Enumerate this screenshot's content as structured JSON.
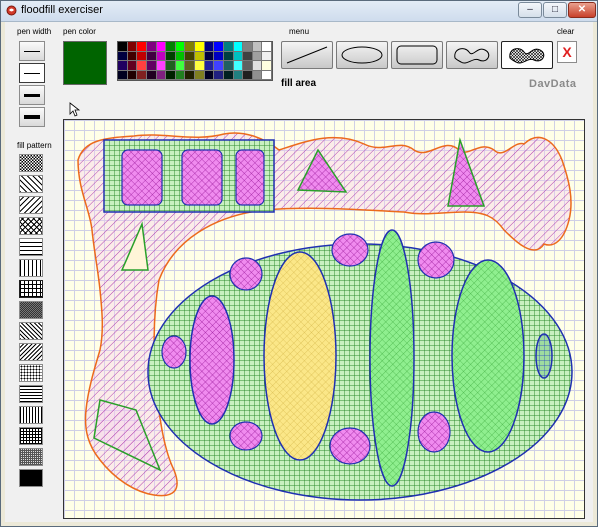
{
  "window": {
    "title": "floodfill exerciser",
    "minimize_glyph": "–",
    "maximize_glyph": "□",
    "close_glyph": "✕"
  },
  "toolbar": {
    "pen_width_label": "pen width",
    "pen_color_label": "pen color",
    "menu_label": "menu",
    "clear_label": "clear",
    "clear_glyph": "X",
    "fill_area_label": "fill area",
    "brand": "DavData",
    "fill_pattern_label": "fill pattern",
    "current_pen_color": "#006400"
  },
  "palette": [
    "#000000",
    "#800000",
    "#ff0000",
    "#800080",
    "#ff00ff",
    "#008000",
    "#00ff00",
    "#808000",
    "#ffff00",
    "#000080",
    "#0000ff",
    "#008080",
    "#00ffff",
    "#808080",
    "#c0c0c0",
    "#ffffff",
    "#000040",
    "#400000",
    "#c00000",
    "#400040",
    "#c000c0",
    "#004000",
    "#00c000",
    "#404000",
    "#c0c000",
    "#000040",
    "#0000c0",
    "#004040",
    "#00c0c0",
    "#404040",
    "#a0a0a0",
    "#f0f0f0",
    "#200060",
    "#600020",
    "#ff4040",
    "#600060",
    "#ff40ff",
    "#206020",
    "#40ff40",
    "#606020",
    "#ffff40",
    "#2020a0",
    "#4040ff",
    "#206060",
    "#40ffff",
    "#606060",
    "#e0e0e0",
    "#ffffe0",
    "#000020",
    "#200000",
    "#802020",
    "#200020",
    "#802080",
    "#002000",
    "#208020",
    "#202000",
    "#808020",
    "#000020",
    "#202080",
    "#002020",
    "#208080",
    "#202020",
    "#909090",
    "#ffffff"
  ],
  "pen_widths": [
    1,
    2,
    3,
    4
  ],
  "menu_tools": [
    "line-tool-icon",
    "ellipse-tool-icon",
    "rounded-rect-tool-icon",
    "freehand-tool-icon",
    "fill-area-tool-icon"
  ],
  "fill_patterns": [
    "dense-checker",
    "diag-down",
    "diag-up",
    "cross-diag",
    "horizontal",
    "vertical",
    "grid",
    "dense-dark",
    "diag-down-2",
    "diag-up-2",
    "dots",
    "horizontal-2",
    "vertical-2",
    "grid-2",
    "fine-grid",
    "solid"
  ]
}
